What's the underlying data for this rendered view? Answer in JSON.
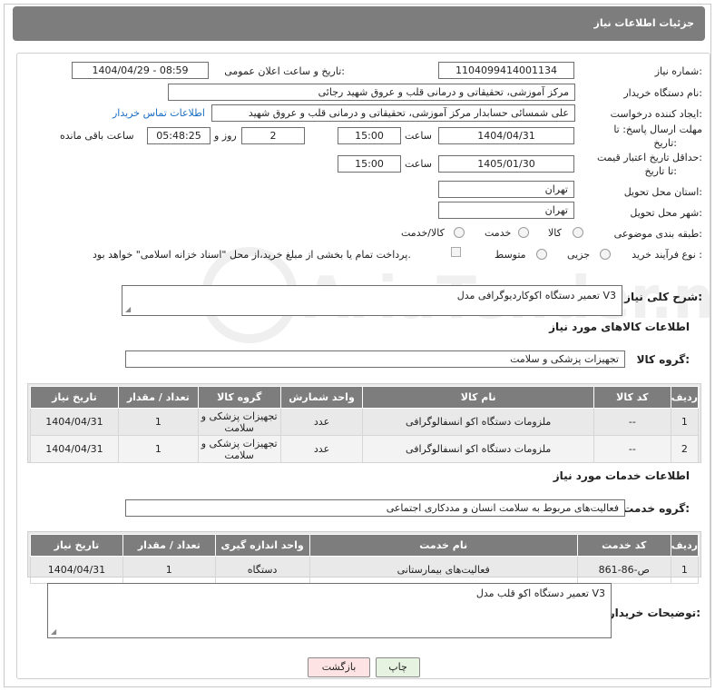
{
  "header": {
    "title": "جزئیات اطلاعات نیاز"
  },
  "form": {
    "need_number": {
      "label": "شماره نیاز:",
      "value": "1104099414001134"
    },
    "announce": {
      "label": "تاریخ و ساعت اعلان عمومی:",
      "value": "1404/04/29 - 08:59"
    },
    "buyer_org": {
      "label": "نام دستگاه خریدار:",
      "value": "مرکز آموزشی، تحقیقاتی و درمانی قلب و عروق شهید رجائی"
    },
    "requester": {
      "label": "ایجاد کننده درخواست:",
      "value": "علی شمسائی حسابدار مرکز آموزشی، تحقیقاتی و درمانی قلب و عروق شهید",
      "contact_link": "اطلاعات تماس خریدار"
    },
    "reply_deadline": {
      "label_line1": "مهلت ارسال پاسخ: تا",
      "label_line2": "تاریخ:",
      "date": "1404/04/31",
      "time_label": "ساعت",
      "time": "15:00",
      "days": "2",
      "days_label": "روز و",
      "remaining": "05:48:25",
      "remaining_label": "ساعت باقی مانده"
    },
    "price_validity": {
      "label_line1": "حداقل تاریخ اعتبار قیمت:",
      "label_line2": "تا تاریخ:",
      "date": "1405/01/30",
      "time_label": "ساعت",
      "time": "15:00"
    },
    "province": {
      "label": "استان محل تحویل:",
      "value": "تهران"
    },
    "city": {
      "label": "شهر محل تحویل:",
      "value": "تهران"
    },
    "category": {
      "label": "طبقه بندی موضوعی:",
      "options": [
        "کالا",
        "خدمت",
        "کالا/خدمت"
      ]
    },
    "process": {
      "label": "نوع فرآیند خرید :",
      "options": [
        "جزیی",
        "متوسط"
      ],
      "note": "پرداخت تمام یا بخشی از مبلغ خرید،از محل \"اسناد خزانه اسلامی\" خواهد بود."
    }
  },
  "description": {
    "label": "شرح کلی نیاز:",
    "value": "تعمیر دستگاه اکوکاردیوگرافی مدل V3"
  },
  "goods": {
    "section_title": "اطلاعات کالاهای مورد نیاز",
    "group_label": "گروه کالا:",
    "group_value": "تجهیزات پزشکی و سلامت",
    "columns": [
      "ردیف",
      "کد کالا",
      "نام کالا",
      "واحد شمارش",
      "گروه کالا",
      "تعداد / مقدار",
      "تاریخ نیاز"
    ],
    "rows": [
      [
        "1",
        "--",
        "ملزومات دستگاه اکو انسفالوگرافی",
        "عدد",
        "تجهیزات پزشکی و سلامت",
        "1",
        "1404/04/31"
      ],
      [
        "2",
        "--",
        "ملزومات دستگاه اکو انسفالوگرافی",
        "عدد",
        "تجهیزات پزشکی و سلامت",
        "1",
        "1404/04/31"
      ]
    ]
  },
  "services": {
    "section_title": "اطلاعات خدمات مورد نیاز",
    "group_label": "گروه خدمت:",
    "group_value": "فعالیت‌های مربوط به سلامت انسان و مددکاری اجتماعی",
    "columns": [
      "ردیف",
      "کد خدمت",
      "نام خدمت",
      "واحد اندازه گیری",
      "تعداد / مقدار",
      "تاریخ نیاز"
    ],
    "rows": [
      [
        "1",
        "ص-86-861",
        "فعالیت‌های بیمارستانی",
        "دستگاه",
        "1",
        "1404/04/31"
      ]
    ]
  },
  "buyer_notes": {
    "label": "توضیحات خریدار:",
    "value": "تعمیر دستگاه اکو قلب مدل V3"
  },
  "buttons": {
    "print": "چاپ",
    "back": "بازگشت"
  },
  "watermark_text": "AriaTender.neT",
  "colors": {
    "header_bg": "#7d7d7d",
    "link": "#1a6fc4",
    "print_btn": "#e5f3e0",
    "back_btn": "#fde3e3"
  }
}
